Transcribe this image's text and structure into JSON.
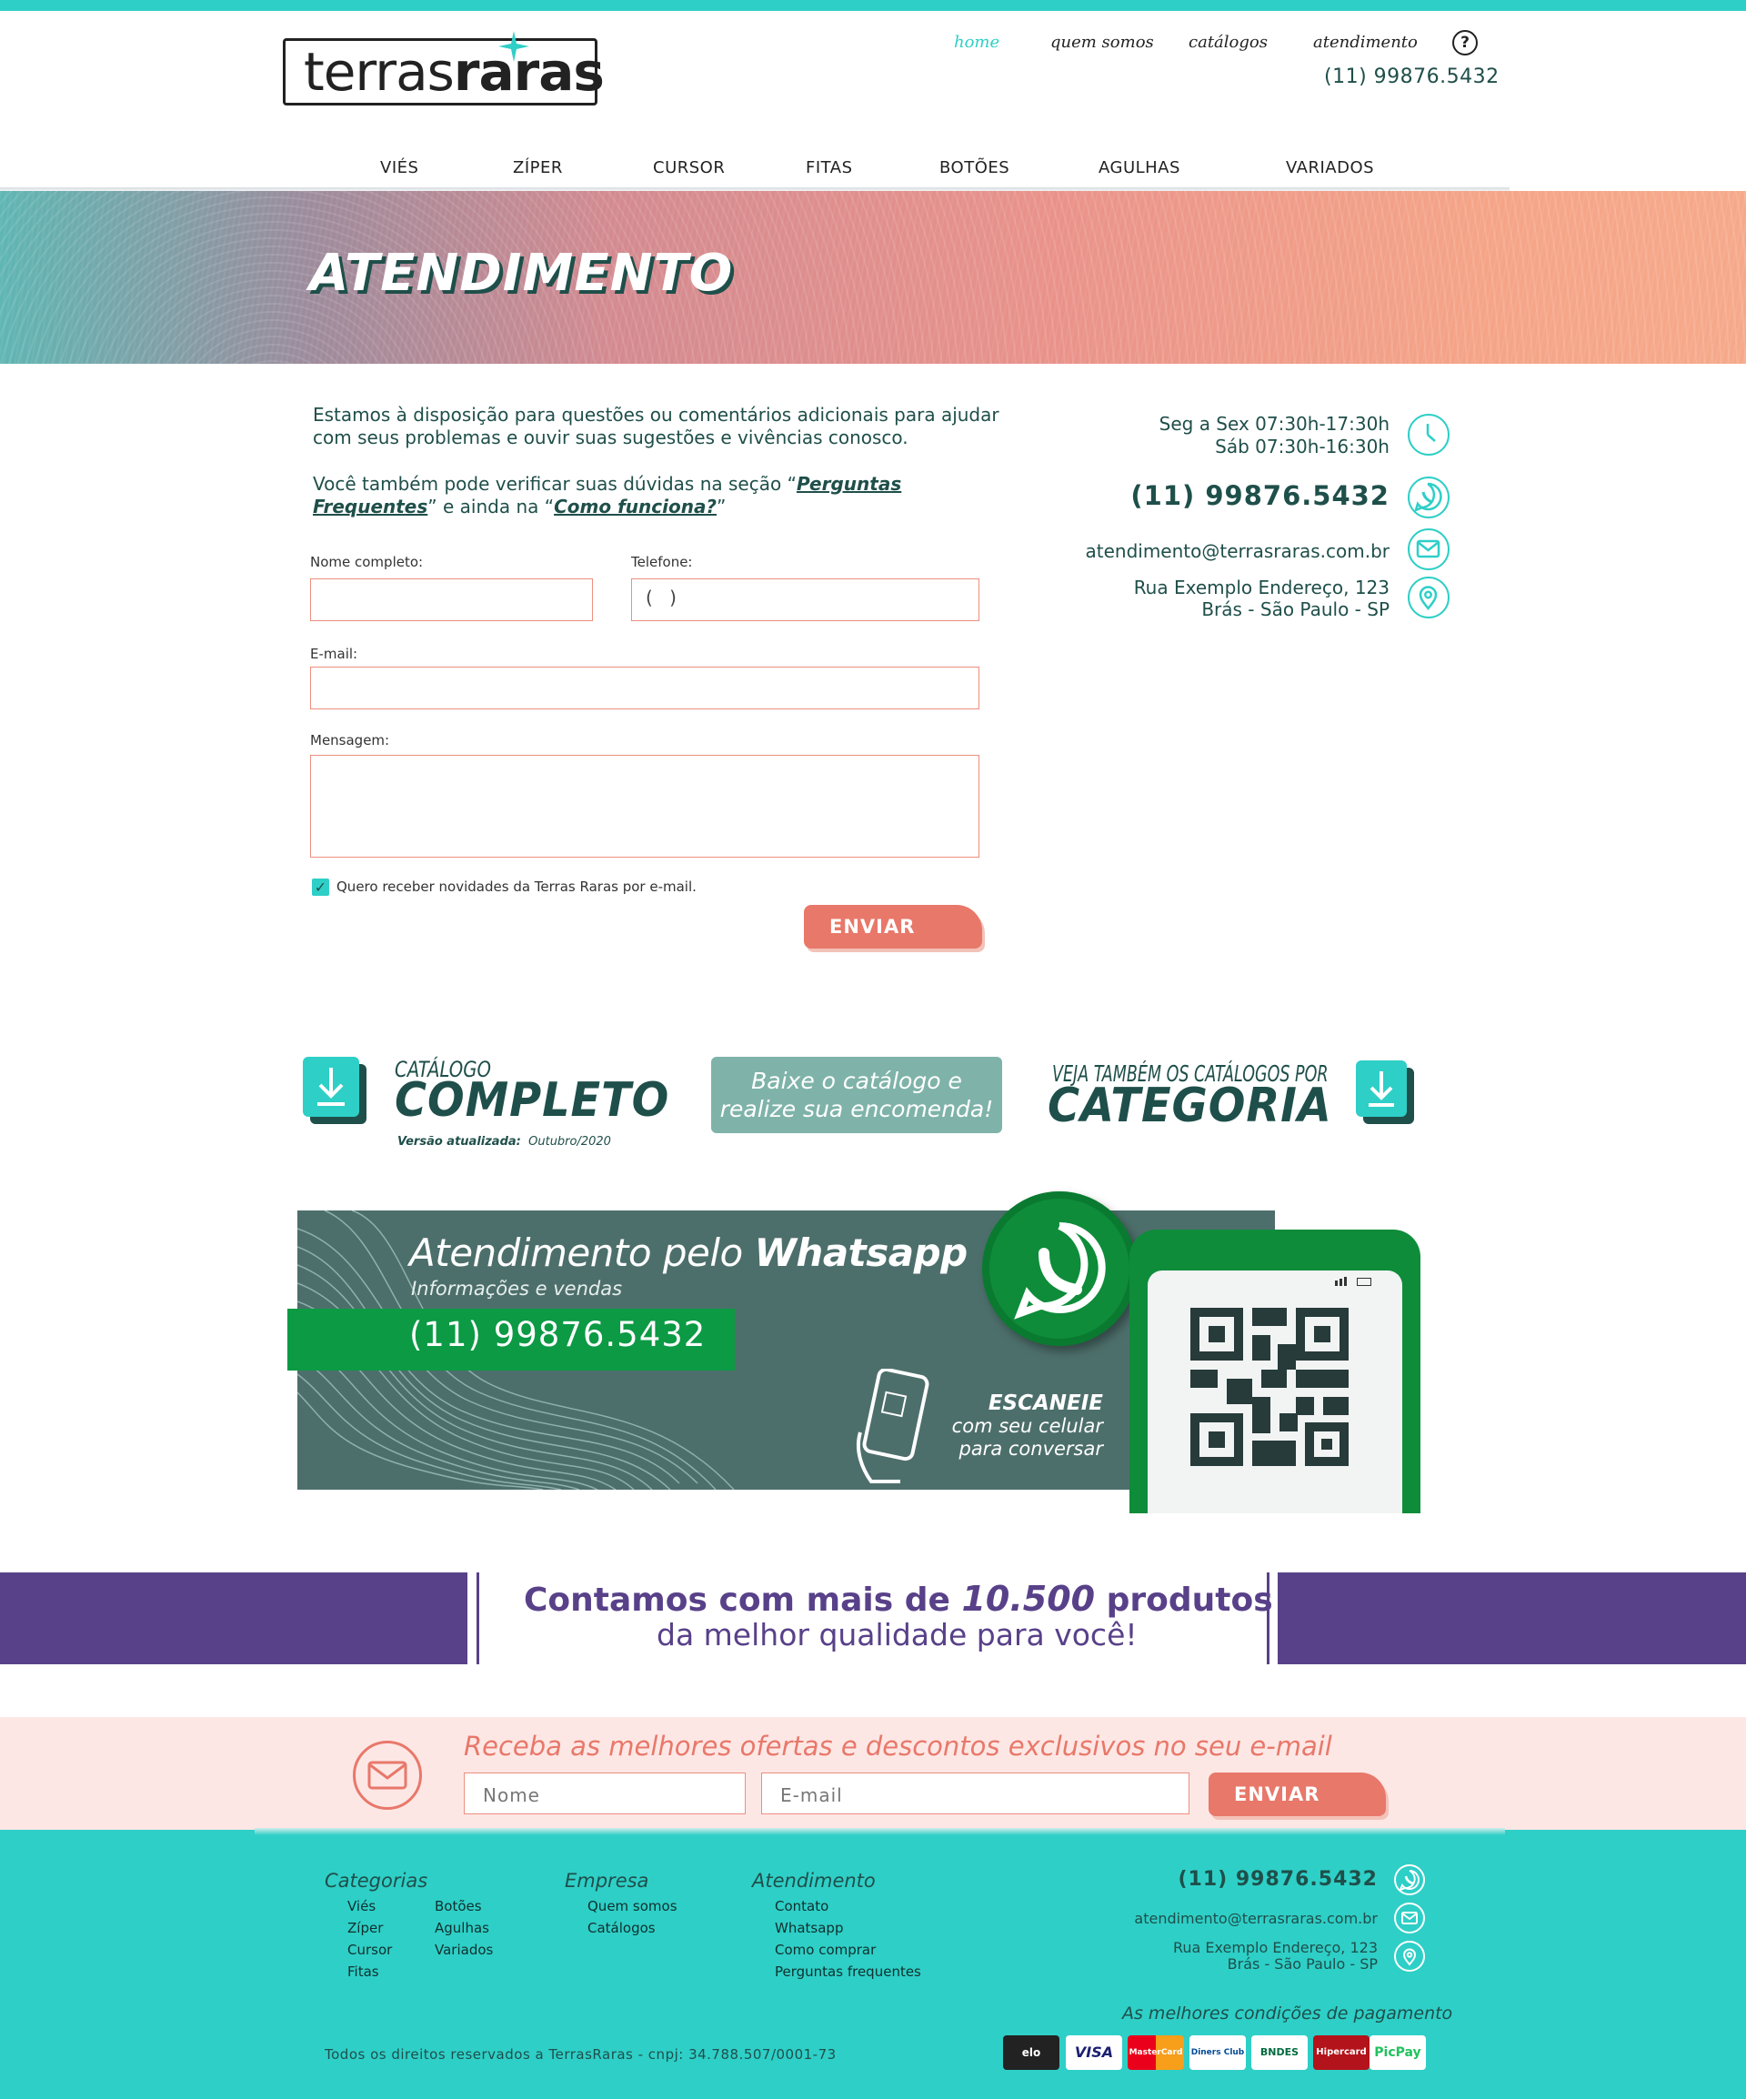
{
  "brand": {
    "logo_text_light": "terras",
    "logo_text_bold": "raras",
    "accent_color": "#2ecfc7",
    "dark_color": "#1f4f4a",
    "coral_color": "#e8786a",
    "purple_color": "#584189"
  },
  "top_nav": {
    "items": [
      "home",
      "quem somos",
      "catálogos",
      "atendimento"
    ],
    "active": "home",
    "help_icon": "question-circle-icon",
    "phone": "(11) 99876.5432"
  },
  "category_nav": [
    "VIÉS",
    "ZÍPER",
    "CURSOR",
    "FITAS",
    "BOTÕES",
    "AGULHAS",
    "VARIADOS"
  ],
  "hero": {
    "title": "ATENDIMENTO"
  },
  "intro": {
    "p1": "Estamos à disposição para questões ou comentários adicionais para ajudar com seus problemas e ouvir suas sugestões e vivências conosco.",
    "p2_before": "Você também pode verificar suas dúvidas na seção “",
    "p2_link1": "Perguntas Frequentes",
    "p2_middle": "” e ainda na “",
    "p2_link2": "Como funciona?",
    "p2_after": "”"
  },
  "form": {
    "name_label": "Nome completo:",
    "phone_label": "Telefone:",
    "phone_placeholder": "( )",
    "email_label": "E-mail:",
    "message_label": "Mensagem:",
    "newsletter_checkbox": "Quero receber novidades da Terras Raras por e-mail.",
    "newsletter_checked": true,
    "submit_label": "ENVIAR"
  },
  "contact": {
    "hours_line1": "Seg a Sex 07:30h-17:30h",
    "hours_line2": "Sáb 07:30h-16:30h",
    "phone": "(11) 99876.5432",
    "email": "atendimento@terrasraras.com.br",
    "address_line1": "Rua Exemplo Endereço, 123",
    "address_line2": "Brás - São Paulo - SP",
    "icons": [
      "clock-icon",
      "whatsapp-icon",
      "mail-icon",
      "location-pin-icon"
    ]
  },
  "catalog": {
    "left_small": "CATÁLOGO",
    "left_big": "COMPLETO",
    "version_label": "Versão atualizada:",
    "version_value": "Outubro/2020",
    "center_line1": "Baixe o catálogo e",
    "center_line2": "realize sua encomenda!",
    "right_small": "VEJA TAMBÉM OS CATÁLOGOS POR",
    "right_big": "CATEGORIA",
    "download_icon": "download-icon"
  },
  "whatsapp_banner": {
    "title_regular": "Atendimento pelo ",
    "title_bold": "Whatsapp",
    "subtitle": "Informações e vendas",
    "phone": "(11) 99876.5432",
    "scan_bold": "ESCANEIE",
    "scan_line2": "com seu celular",
    "scan_line3": "para conversar"
  },
  "products_strip": {
    "line1_before": "Contamos com mais de ",
    "line1_number": "10.500",
    "line1_after": " produtos",
    "line2": "da melhor qualidade para você!"
  },
  "newsletter": {
    "title": "Receba as melhores ofertas e descontos exclusivos no seu e-mail",
    "name_placeholder": "Nome",
    "email_placeholder": "E-mail",
    "submit_label": "ENVIAR"
  },
  "footer": {
    "categorias": {
      "title": "Categorias",
      "col1": [
        "Viés",
        "Zíper",
        "Cursor",
        "Fitas"
      ],
      "col2": [
        "Botões",
        "Agulhas",
        "Variados"
      ]
    },
    "empresa": {
      "title": "Empresa",
      "items": [
        "Quem somos",
        "Catálogos"
      ]
    },
    "atendimento": {
      "title": "Atendimento",
      "items": [
        "Contato",
        "Whatsapp",
        "Como comprar",
        "Perguntas frequentes"
      ]
    },
    "phone": "(11) 99876.5432",
    "email": "atendimento@terrasraras.com.br",
    "address_line1": "Rua Exemplo Endereço, 123",
    "address_line2": "Brás - São Paulo - SP",
    "payment_title": "As melhores condições de pagamento",
    "payment_methods": [
      "elo",
      "VISA",
      "MasterCard",
      "Diners Club",
      "BNDES",
      "Hipercard",
      "PicPay"
    ],
    "copyright": "Todos os direitos reservados a TerrasRaras - cnpj: 34.788.507/0001-73"
  }
}
